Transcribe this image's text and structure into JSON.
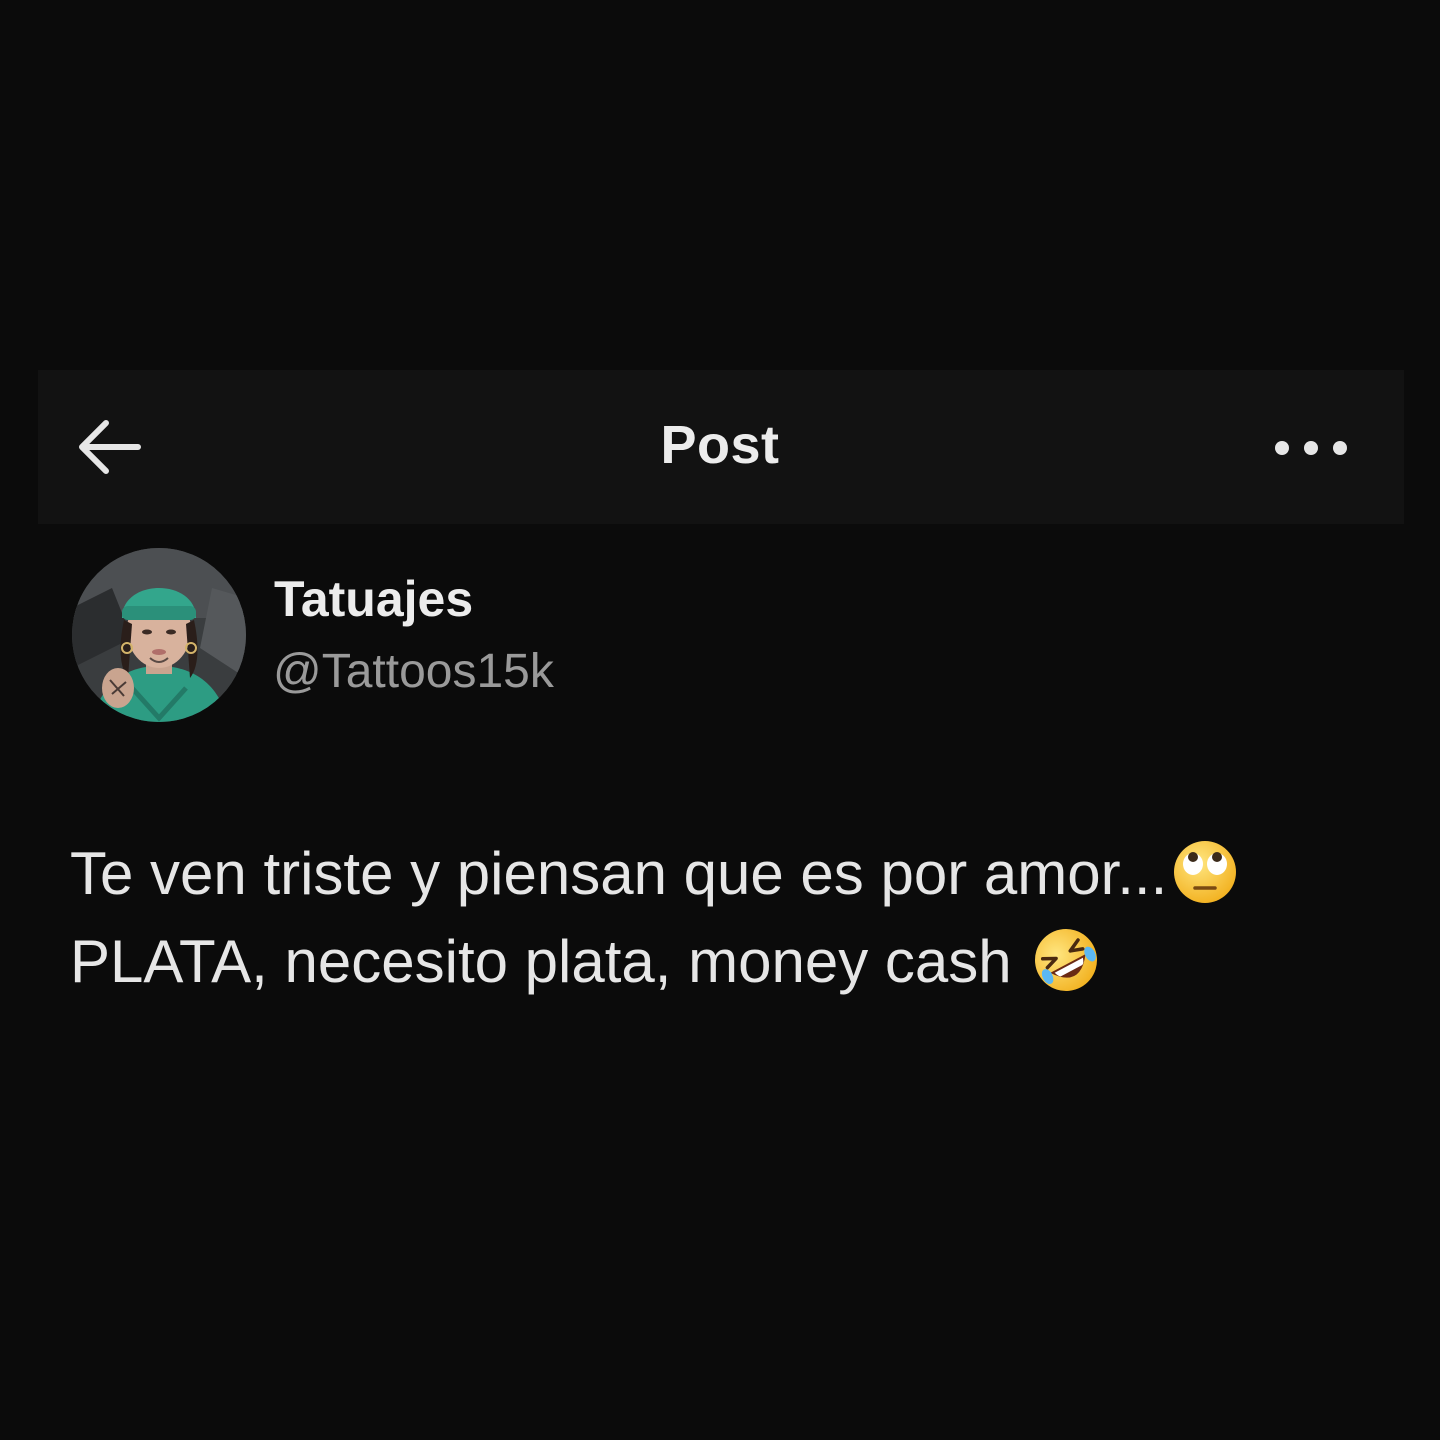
{
  "header": {
    "title": "Post",
    "back_icon": "arrow-left-icon",
    "more_icon": "more-horizontal-icon"
  },
  "author": {
    "display_name": "Tatuajes",
    "handle": "@Tattoos15k",
    "avatar_icon": "profile-avatar"
  },
  "post": {
    "line1": "Te ven triste y piensan que es por amor...",
    "line1_emoji": "face-with-rolling-eyes-icon",
    "line2": "PLATA, necesito plata, money cash ",
    "line2_emoji": "rolling-on-the-floor-laughing-icon"
  },
  "colors": {
    "background": "#0b0b0b",
    "header_background": "#121212",
    "primary_text": "#e9e9e9",
    "secondary_text": "#9a9a9a"
  }
}
